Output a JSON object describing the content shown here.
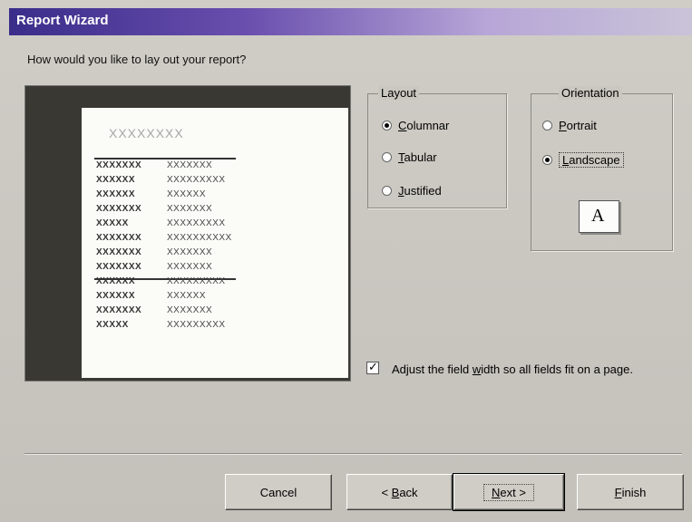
{
  "window": {
    "title": "Report Wizard"
  },
  "question": "How would you like to lay out your report?",
  "preview": {
    "heading": "XXXXXXXX",
    "rows": [
      {
        "label": "XXXXXXX",
        "value": "XXXXXXX"
      },
      {
        "label": "XXXXXX",
        "value": "XXXXXXXXX"
      },
      {
        "label": "XXXXXX",
        "value": "XXXXXX"
      },
      {
        "label": "XXXXXXX",
        "value": "XXXXXXX"
      },
      {
        "label": "XXXXX",
        "value": "XXXXXXXXX"
      },
      {
        "label": "XXXXXXX",
        "value": "XXXXXXXXXX"
      },
      {
        "label": "XXXXXXX",
        "value": "XXXXXXX"
      },
      {
        "label": "XXXXXXX",
        "value": "XXXXXXX"
      },
      {
        "label": "XXXXXX",
        "value": "XXXXXXXXX"
      },
      {
        "label": "XXXXXX",
        "value": "XXXXXX"
      },
      {
        "label": "XXXXXXX",
        "value": "XXXXXXX"
      },
      {
        "label": "XXXXX",
        "value": "XXXXXXXXX"
      }
    ]
  },
  "layout": {
    "title": "Layout",
    "options": [
      {
        "mnemonic": "C",
        "rest": "olumnar",
        "selected": true
      },
      {
        "mnemonic": "T",
        "rest": "abular",
        "selected": false
      },
      {
        "mnemonic": "J",
        "rest": "ustified",
        "selected": false
      }
    ]
  },
  "orientation": {
    "title": "Orientation",
    "portrait": {
      "mnemonic": "P",
      "rest": "ortrait",
      "selected": false
    },
    "landscape": {
      "mnemonic": "L",
      "rest": "andscape",
      "selected": true
    },
    "icon_letter": "A"
  },
  "adjust": {
    "checked": true,
    "check_mark": "✓",
    "before": "Adjust the field ",
    "mnemonic": "w",
    "after": "idth so all fields fit on a page."
  },
  "buttons": {
    "cancel": "Cancel",
    "back": {
      "prefix": "< ",
      "mnemonic": "B",
      "rest": "ack"
    },
    "next": {
      "mnemonic": "N",
      "rest": "ext >"
    },
    "finish": {
      "mnemonic": "F",
      "rest": "inish"
    }
  }
}
